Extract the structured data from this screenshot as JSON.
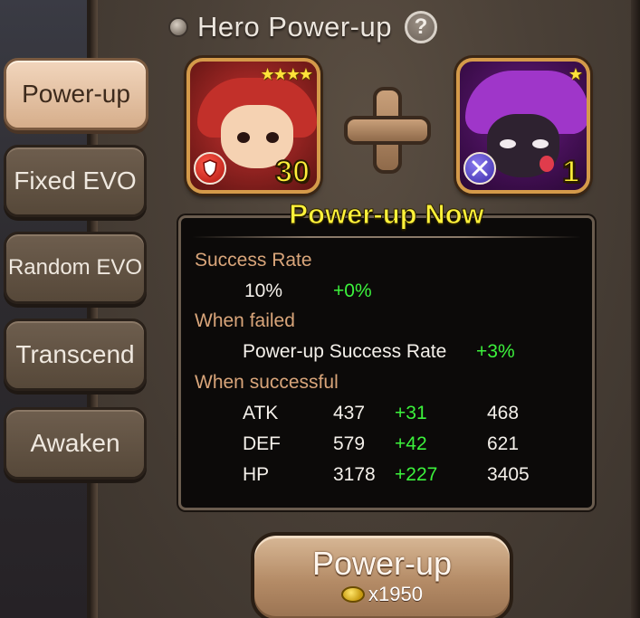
{
  "header": {
    "title": "Hero Power-up",
    "help_label": "?"
  },
  "tabs": [
    {
      "label": "Power-up",
      "active": true
    },
    {
      "label": "Fixed EVO",
      "active": false
    },
    {
      "label": "Random EVO",
      "active": false
    },
    {
      "label": "Transcend",
      "active": false
    },
    {
      "label": "Awaken",
      "active": false
    }
  ],
  "heroes": {
    "main": {
      "level": "30",
      "stars": "★★★★",
      "class_icon": "shield-icon"
    },
    "material": {
      "level": "1",
      "stars": "★",
      "class_icon": "crossed-swords-icon"
    }
  },
  "info": {
    "title": "Power-up Now",
    "success_rate_label": "Success Rate",
    "success_rate_value": "10%",
    "success_rate_bonus": "+0%",
    "when_failed_label": "When failed",
    "failed_stat_label": "Power-up Success Rate",
    "failed_stat_bonus": "+3%",
    "when_successful_label": "When successful",
    "stats": [
      {
        "name": "ATK",
        "current": "437",
        "bonus": "+31",
        "result": "468"
      },
      {
        "name": "DEF",
        "current": "579",
        "bonus": "+42",
        "result": "621"
      },
      {
        "name": "HP",
        "current": "3178",
        "bonus": "+227",
        "result": "3405"
      }
    ]
  },
  "action": {
    "label": "Power-up",
    "cost": "x1950",
    "currency_icon": "gold-coin-icon"
  },
  "colors": {
    "title_yellow": "#fff23a",
    "bonus_green": "#3cf23c",
    "label_tan": "#d9a57a"
  }
}
